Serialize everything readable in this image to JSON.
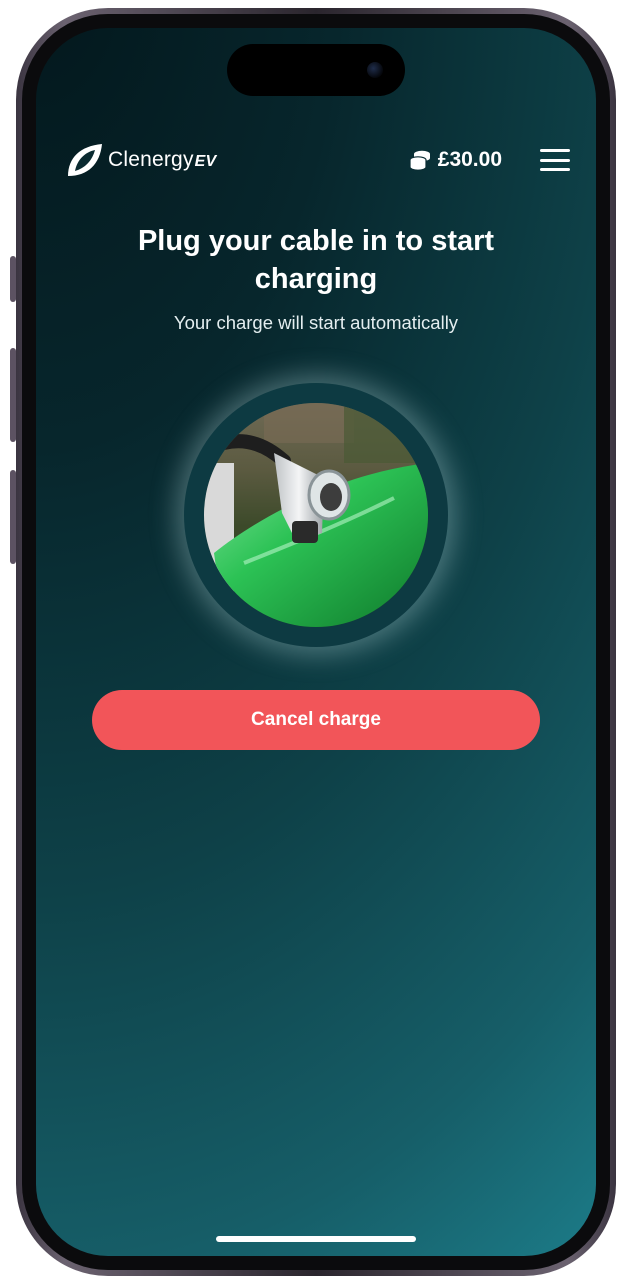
{
  "app": {
    "logo_text": "Clenergy",
    "logo_suffix": "EV"
  },
  "header": {
    "balance": "£30.00",
    "balance_icon": "coins-icon",
    "menu_icon": "hamburger-menu-icon"
  },
  "main": {
    "title": "Plug your cable in to start charging",
    "subtitle": "Your charge will start automatically",
    "image_icon": "ev-charger-plug-image",
    "cancel_label": "Cancel charge"
  },
  "colors": {
    "accent_button": "#f25559",
    "background_dark": "#03171c",
    "background_light": "#1d7f8c"
  }
}
